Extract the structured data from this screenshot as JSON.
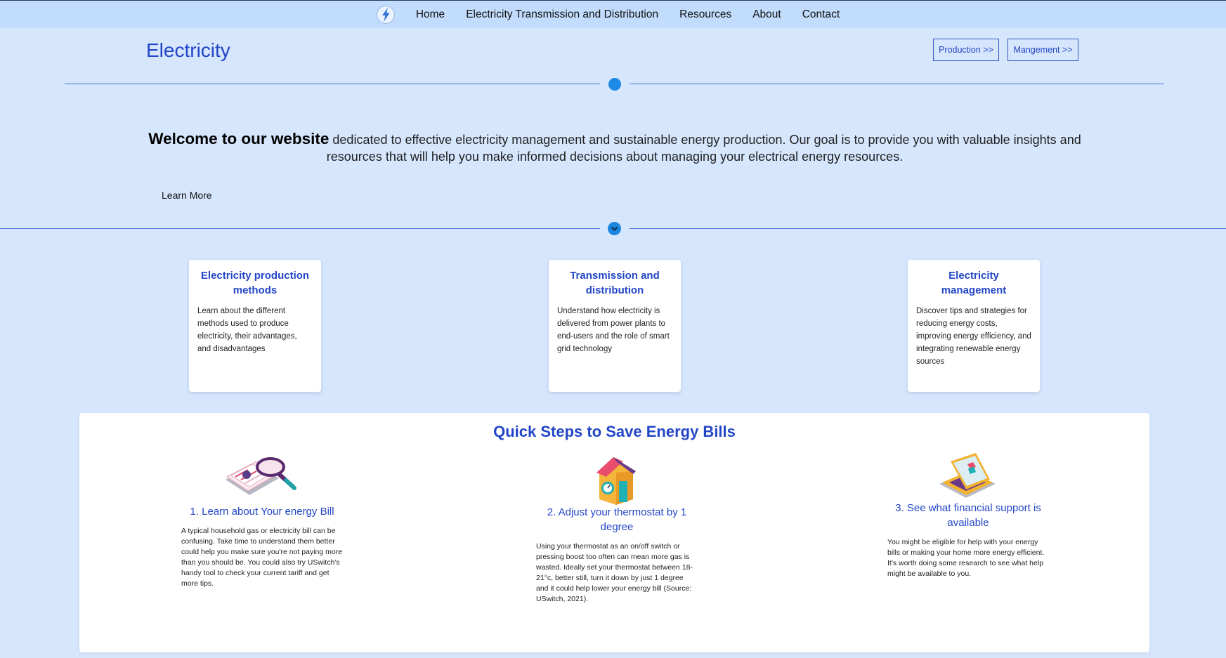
{
  "nav": {
    "logo_icon": "lightning-bolt-icon",
    "items": [
      {
        "label": "Home"
      },
      {
        "label": "Electricity Transmission and Distribution"
      },
      {
        "label": "Resources"
      },
      {
        "label": "About"
      },
      {
        "label": "Contact"
      }
    ]
  },
  "header": {
    "title": "Electricity",
    "production_button": "Production >>",
    "management_button": "Mangement >>"
  },
  "welcome": {
    "bold": "Welcome to our website",
    "text": " dedicated to effective electricity management and sustainable energy production. Our goal is to provide you with valuable insights and resources that will help you make informed decisions about managing your electrical energy resources.",
    "learn_more": "Learn More"
  },
  "cards": [
    {
      "title": "Electricity production methods",
      "text": "Learn about the different methods used to produce electricity, their advantages, and disadvantages"
    },
    {
      "title": "Transmission and distribution",
      "text": "Understand how electricity is delivered from power plants to end-users and the role of smart grid technology"
    },
    {
      "title": "Electricity management",
      "text": "Discover tips and strategies for reducing energy costs, improving energy efficiency, and integrating renewable energy sources"
    }
  ],
  "steps": {
    "title": "Quick Steps to Save Energy Bills",
    "items": [
      {
        "icon": "bill-magnifier-icon",
        "title": "1. Learn about Your energy Bill",
        "text": "A typical household gas or electricity bill can be confusing. Take time to understand them better could help you make sure you're not paying more than you should be. You could also try USwitch's handy tool to check your current tariff and get more tips."
      },
      {
        "icon": "house-thermostat-icon",
        "title": "2. Adjust your thermostat by 1 degree",
        "text": "Using your thermostat as an on/off switch or pressing boost too often can mean more gas is wasted. Ideally set your thermostat between 18-21°c, better still, turn it down by just 1 degree and it could help lower your energy bill (Source: USwitch, 2021)."
      },
      {
        "icon": "laptop-house-icon",
        "title": "3. See what financial support is available",
        "text": "You might be eligible for help with your energy bills or making your home more energy efficient. It's worth doing some research to see what help might be available to you."
      }
    ]
  },
  "colors": {
    "accent": "#2346c6",
    "background": "#d6e6fd",
    "navbar": "#c2dcfd",
    "dot": "#1f8ae6"
  }
}
